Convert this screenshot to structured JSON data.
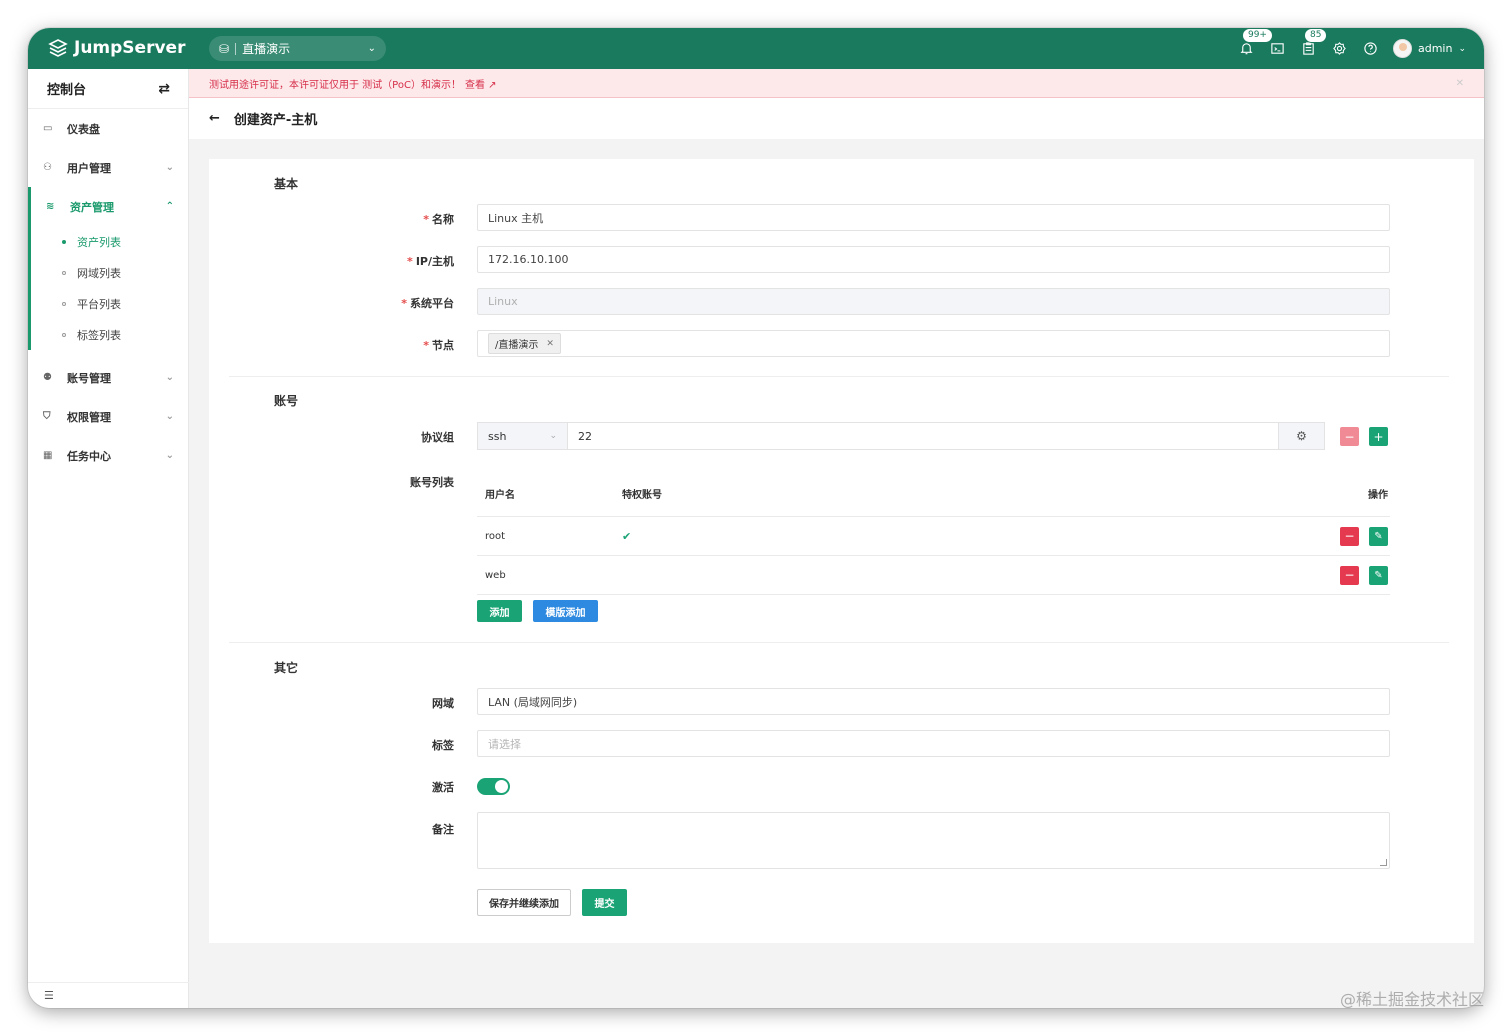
{
  "app": {
    "name": "JumpServer"
  },
  "header": {
    "org": "直播演示",
    "notifications_badge": "99+",
    "tasks_badge": "85",
    "user": "admin"
  },
  "sidebar": {
    "title": "控制台",
    "items": [
      {
        "label": "仪表盘",
        "icon": "dashboard-icon"
      },
      {
        "label": "用户管理",
        "icon": "users-icon"
      },
      {
        "label": "资产管理",
        "icon": "stack-icon"
      },
      {
        "label": "账号管理",
        "icon": "account-icon"
      },
      {
        "label": "权限管理",
        "icon": "shield-icon"
      },
      {
        "label": "任务中心",
        "icon": "calendar-icon"
      }
    ],
    "asset_sub": [
      "资产列表",
      "网域列表",
      "平台列表",
      "标签列表"
    ]
  },
  "banner": {
    "text": "测试用途许可证，本许可证仅用于 测试（PoC）和演示！",
    "link": "查看"
  },
  "page": {
    "title": "创建资产-主机"
  },
  "form": {
    "section_basic": "基本",
    "name_label": "名称",
    "name_value": "Linux 主机",
    "ip_label": "IP/主机",
    "ip_value": "172.16.10.100",
    "platform_label": "系统平台",
    "platform_value": "Linux",
    "node_label": "节点",
    "node_tag": "/直播演示",
    "section_account": "账号",
    "protocol_label": "协议组",
    "protocol_name": "ssh",
    "protocol_port": "22",
    "accounts_label": "账号列表",
    "accounts_headers": {
      "username": "用户名",
      "privileged": "特权账号",
      "actions": "操作"
    },
    "accounts": [
      {
        "username": "root",
        "privileged": "✔"
      },
      {
        "username": "web",
        "privileged": ""
      }
    ],
    "add_btn": "添加",
    "template_add_btn": "模版添加",
    "section_other": "其它",
    "domain_label": "网域",
    "domain_value": "LAN (局域网同步)",
    "labels_label": "标签",
    "labels_placeholder": "请选择",
    "active_label": "激活",
    "active": true,
    "comment_label": "备注",
    "save_continue_btn": "保存并继续添加",
    "submit_btn": "提交"
  },
  "watermark": "@稀土掘金技术社区",
  "colors": {
    "brand": "#1a7a5e",
    "accent": "#1aa374",
    "danger": "#e53950",
    "info": "#2d8ae0"
  }
}
